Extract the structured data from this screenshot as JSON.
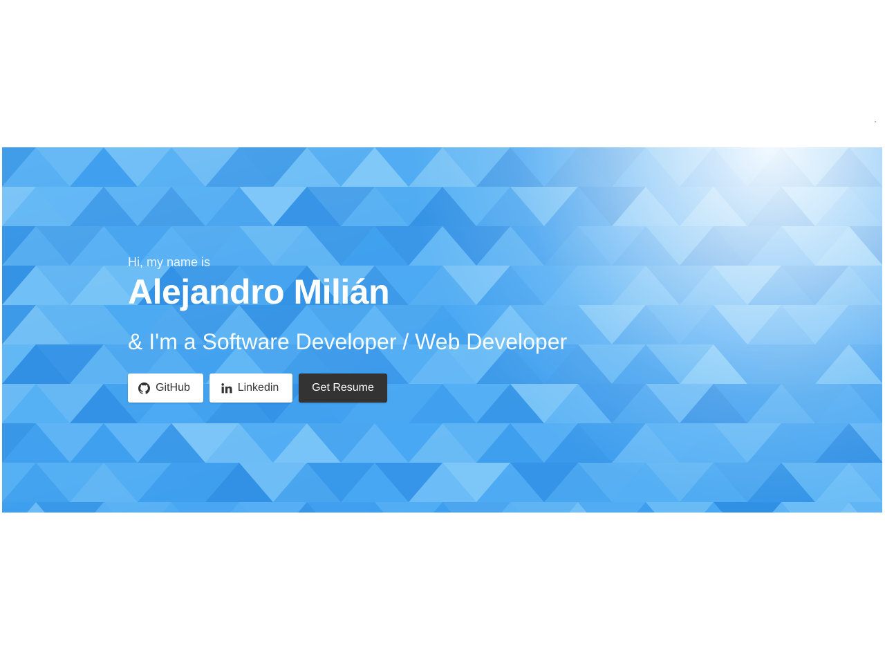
{
  "hero": {
    "greeting": "Hi, my name is",
    "name": "Alejandro Milián",
    "tagline": "& I'm a Software Developer / Web Developer"
  },
  "buttons": {
    "github": {
      "label": "GitHub",
      "icon": "github-icon"
    },
    "linkedin": {
      "label": "Linkedin",
      "icon": "linkedin-icon"
    },
    "resume": {
      "label": "Get Resume"
    }
  },
  "colors": {
    "hero_blue": "#45a4f2",
    "hero_light": "#a9d8fa",
    "button_dark": "#333333",
    "button_light": "#ffffff",
    "text_white": "#ffffff"
  }
}
